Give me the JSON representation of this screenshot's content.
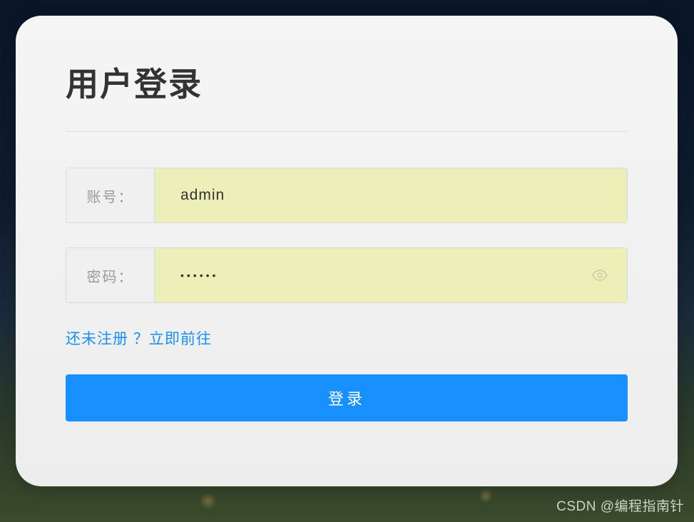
{
  "login": {
    "title": "用户登录",
    "fields": {
      "username": {
        "label": "账号：",
        "value": "admin"
      },
      "password": {
        "label": "密码：",
        "value": "••••••"
      }
    },
    "register_link": "还未注册 ？立即前往",
    "submit_label": "登录"
  },
  "watermark": "CSDN @编程指南针"
}
